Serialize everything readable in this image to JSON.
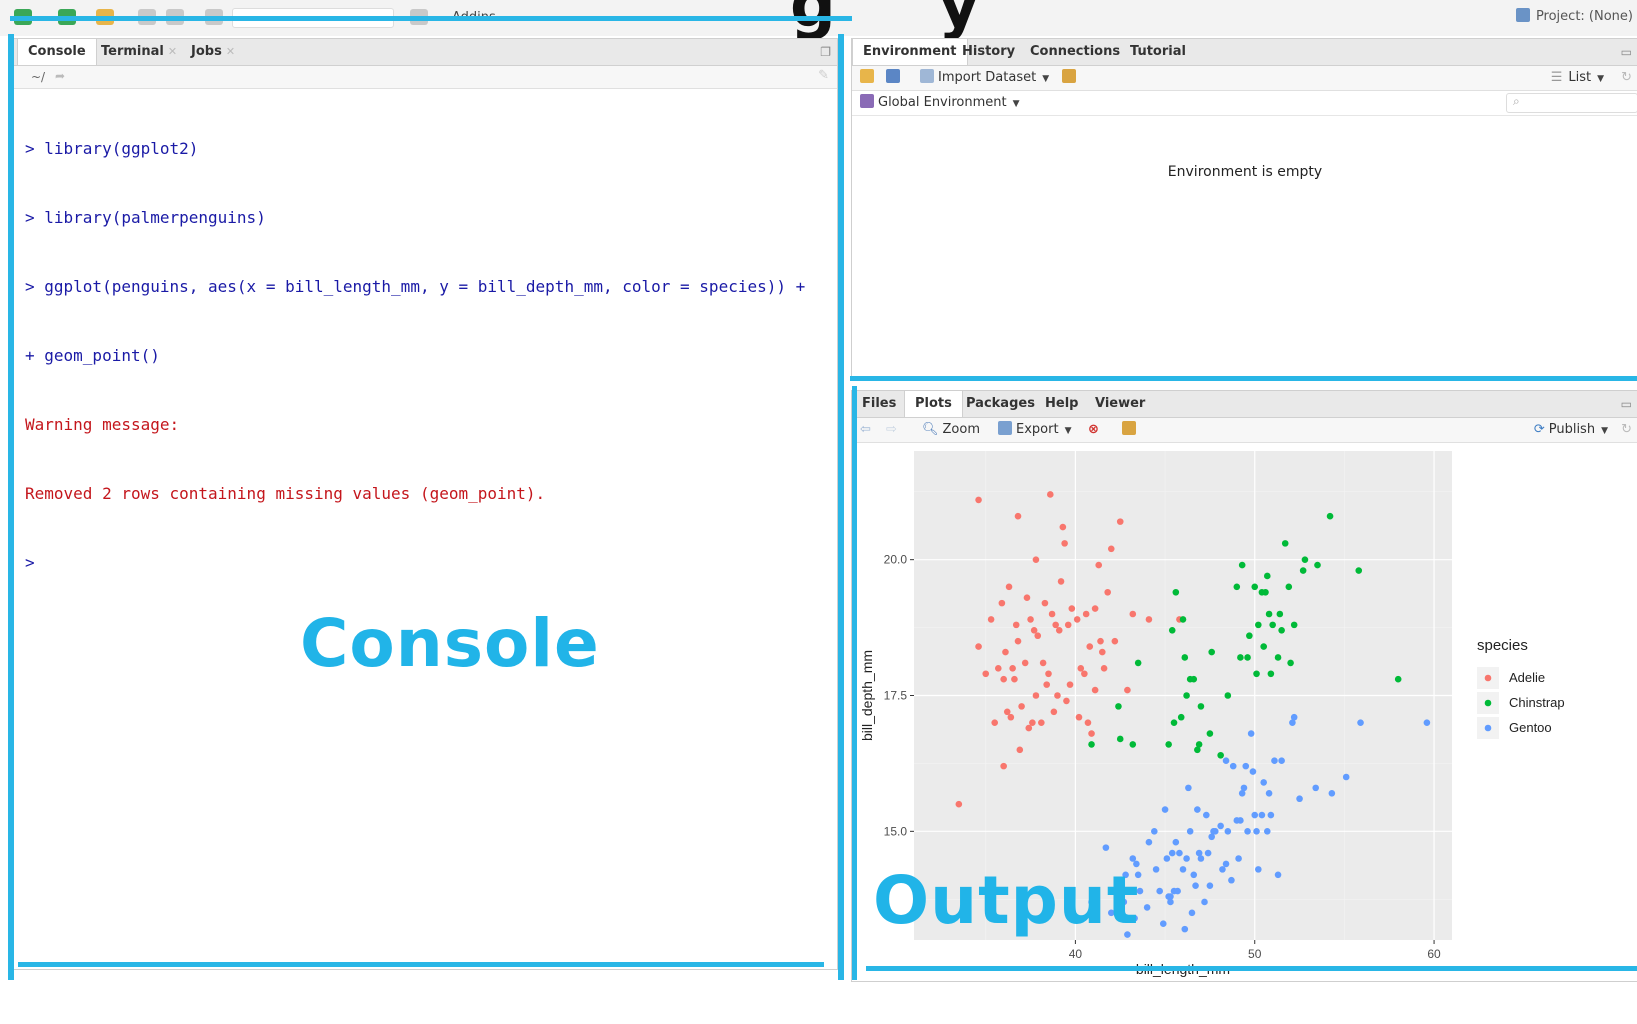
{
  "top_bar": {
    "addins_label": "Addins",
    "project_label": "Project: (None)"
  },
  "console_pane": {
    "tabs": [
      {
        "label": "Console",
        "active": true
      },
      {
        "label": "Terminal",
        "closable": true
      },
      {
        "label": "Jobs",
        "closable": true
      }
    ],
    "path": "~/",
    "lines": [
      {
        "kind": "cmd",
        "text": "> library(ggplot2)"
      },
      {
        "kind": "cmd",
        "text": "> library(palmerpenguins)"
      },
      {
        "kind": "cmd",
        "text": "> ggplot(penguins, aes(x = bill_length_mm, y = bill_depth_mm, color = species)) +"
      },
      {
        "kind": "cmd",
        "text": "+ geom_point()"
      },
      {
        "kind": "warn",
        "text": "Warning message:"
      },
      {
        "kind": "warn",
        "text": "Removed 2 rows containing missing values (geom_point)."
      },
      {
        "kind": "cmd",
        "text": ">"
      }
    ],
    "annotation": "Console"
  },
  "environment_pane": {
    "tabs": [
      "Environment",
      "History",
      "Connections",
      "Tutorial"
    ],
    "active_tab": "Environment",
    "toolbar": {
      "import_label": "Import Dataset",
      "list_label": "List"
    },
    "scope_label": "Global Environment",
    "empty_message": "Environment is empty"
  },
  "output_pane": {
    "tabs": [
      "Files",
      "Plots",
      "Packages",
      "Help",
      "Viewer"
    ],
    "active_tab": "Plots",
    "toolbar": {
      "zoom_label": "Zoom",
      "export_label": "Export",
      "publish_label": "Publish"
    },
    "annotation": "Output"
  },
  "colors": {
    "adelie": "#F8766D",
    "chinstrap": "#00BA38",
    "gentoo": "#619CFF",
    "annotation": "#29B6E6",
    "console_cmd": "#1A1AA6",
    "console_warn": "#C4161C"
  },
  "chart_data": {
    "type": "scatter",
    "xlabel": "bill_length_mm",
    "ylabel": "bill_depth_mm",
    "xlim": [
      31,
      61
    ],
    "ylim": [
      13,
      22
    ],
    "xticks": [
      40,
      50,
      60
    ],
    "yticks": [
      15.0,
      17.5,
      20.0
    ],
    "ytick_labels": [
      "15.0",
      "17.5",
      "20.0"
    ],
    "grid": true,
    "legend_title": "species",
    "legend_position": "right",
    "series": [
      {
        "name": "Adelie",
        "color": "#F8766D",
        "points": [
          [
            33.5,
            15.5
          ],
          [
            34.6,
            18.4
          ],
          [
            34.6,
            21.1
          ],
          [
            35.0,
            17.9
          ],
          [
            35.3,
            18.9
          ],
          [
            35.5,
            17.0
          ],
          [
            35.7,
            18.0
          ],
          [
            36.0,
            16.2
          ],
          [
            36.0,
            17.8
          ],
          [
            36.2,
            17.2
          ],
          [
            36.4,
            17.1
          ],
          [
            36.5,
            18.0
          ],
          [
            36.6,
            17.8
          ],
          [
            36.7,
            18.8
          ],
          [
            36.8,
            18.5
          ],
          [
            36.9,
            16.5
          ],
          [
            37.0,
            17.3
          ],
          [
            37.2,
            18.1
          ],
          [
            37.3,
            19.3
          ],
          [
            37.6,
            17.0
          ],
          [
            37.7,
            18.7
          ],
          [
            37.8,
            17.5
          ],
          [
            37.8,
            20.0
          ],
          [
            38.1,
            17.0
          ],
          [
            38.2,
            18.1
          ],
          [
            38.5,
            17.9
          ],
          [
            38.6,
            21.2
          ],
          [
            38.8,
            17.2
          ],
          [
            38.9,
            18.8
          ],
          [
            39.0,
            17.5
          ],
          [
            39.2,
            19.6
          ],
          [
            39.3,
            20.6
          ],
          [
            39.5,
            17.4
          ],
          [
            39.6,
            18.8
          ],
          [
            39.7,
            17.7
          ],
          [
            40.1,
            18.9
          ],
          [
            40.3,
            18.0
          ],
          [
            40.5,
            17.9
          ],
          [
            40.6,
            19.0
          ],
          [
            40.8,
            18.4
          ],
          [
            41.1,
            17.6
          ],
          [
            41.1,
            19.1
          ],
          [
            41.4,
            18.5
          ],
          [
            41.5,
            18.3
          ],
          [
            41.8,
            19.4
          ],
          [
            42.0,
            20.2
          ],
          [
            42.2,
            18.5
          ],
          [
            42.5,
            20.7
          ],
          [
            42.9,
            17.6
          ],
          [
            43.2,
            19.0
          ],
          [
            44.1,
            18.9
          ],
          [
            45.8,
            18.9
          ],
          [
            39.8,
            19.1
          ],
          [
            36.3,
            19.5
          ],
          [
            37.4,
            16.9
          ],
          [
            38.3,
            19.2
          ],
          [
            40.9,
            16.8
          ],
          [
            39.1,
            18.7
          ],
          [
            41.6,
            18.0
          ],
          [
            37.9,
            18.6
          ],
          [
            36.1,
            18.3
          ],
          [
            38.7,
            19.0
          ],
          [
            40.2,
            17.1
          ],
          [
            35.9,
            19.2
          ],
          [
            39.4,
            20.3
          ],
          [
            40.7,
            17.0
          ],
          [
            37.5,
            18.9
          ],
          [
            38.4,
            17.7
          ],
          [
            41.3,
            19.9
          ],
          [
            36.8,
            20.8
          ]
        ]
      },
      {
        "name": "Chinstrap",
        "color": "#00BA38",
        "points": [
          [
            40.9,
            16.6
          ],
          [
            42.4,
            17.3
          ],
          [
            42.5,
            16.7
          ],
          [
            43.2,
            16.6
          ],
          [
            43.5,
            18.1
          ],
          [
            45.2,
            16.6
          ],
          [
            45.4,
            18.7
          ],
          [
            45.5,
            17.0
          ],
          [
            45.6,
            19.4
          ],
          [
            46.0,
            18.9
          ],
          [
            46.1,
            18.2
          ],
          [
            46.4,
            17.8
          ],
          [
            46.6,
            17.8
          ],
          [
            46.8,
            16.5
          ],
          [
            47.0,
            17.3
          ],
          [
            47.5,
            16.8
          ],
          [
            48.1,
            16.4
          ],
          [
            49.0,
            19.5
          ],
          [
            49.3,
            19.9
          ],
          [
            49.6,
            18.2
          ],
          [
            50.0,
            19.5
          ],
          [
            50.2,
            18.8
          ],
          [
            50.4,
            19.4
          ],
          [
            50.5,
            18.4
          ],
          [
            50.7,
            19.7
          ],
          [
            50.9,
            17.9
          ],
          [
            51.3,
            18.2
          ],
          [
            51.4,
            19.0
          ],
          [
            51.5,
            18.7
          ],
          [
            51.9,
            19.5
          ],
          [
            52.0,
            18.1
          ],
          [
            52.2,
            18.8
          ],
          [
            52.8,
            20.0
          ],
          [
            53.5,
            19.9
          ],
          [
            54.2,
            20.8
          ],
          [
            55.8,
            19.8
          ],
          [
            58.0,
            17.8
          ],
          [
            49.7,
            18.6
          ],
          [
            50.8,
            19.0
          ],
          [
            47.6,
            18.3
          ],
          [
            46.2,
            17.5
          ],
          [
            48.5,
            17.5
          ],
          [
            51.0,
            18.8
          ],
          [
            45.9,
            17.1
          ],
          [
            49.2,
            18.2
          ],
          [
            52.7,
            19.8
          ],
          [
            50.6,
            19.4
          ],
          [
            50.1,
            17.9
          ],
          [
            51.7,
            20.3
          ],
          [
            46.9,
            16.6
          ]
        ]
      },
      {
        "name": "Gentoo",
        "color": "#619CFF",
        "points": [
          [
            40.9,
            13.7
          ],
          [
            41.7,
            14.7
          ],
          [
            42.0,
            13.5
          ],
          [
            42.7,
            13.7
          ],
          [
            42.8,
            14.2
          ],
          [
            42.9,
            13.1
          ],
          [
            43.2,
            14.5
          ],
          [
            43.3,
            13.4
          ],
          [
            43.4,
            14.4
          ],
          [
            43.5,
            14.2
          ],
          [
            43.6,
            13.9
          ],
          [
            44.0,
            13.6
          ],
          [
            44.4,
            15.0
          ],
          [
            44.5,
            14.3
          ],
          [
            44.9,
            13.3
          ],
          [
            45.0,
            15.4
          ],
          [
            45.1,
            14.5
          ],
          [
            45.2,
            13.8
          ],
          [
            45.3,
            13.7
          ],
          [
            45.4,
            14.6
          ],
          [
            45.5,
            13.9
          ],
          [
            45.7,
            13.9
          ],
          [
            45.8,
            14.6
          ],
          [
            46.1,
            13.2
          ],
          [
            46.2,
            14.5
          ],
          [
            46.3,
            15.8
          ],
          [
            46.4,
            15.0
          ],
          [
            46.5,
            13.5
          ],
          [
            46.6,
            14.2
          ],
          [
            46.8,
            15.4
          ],
          [
            46.9,
            14.6
          ],
          [
            47.2,
            13.7
          ],
          [
            47.3,
            15.3
          ],
          [
            47.4,
            14.6
          ],
          [
            47.5,
            14.0
          ],
          [
            47.7,
            15.0
          ],
          [
            47.8,
            15.0
          ],
          [
            48.1,
            15.1
          ],
          [
            48.2,
            14.3
          ],
          [
            48.4,
            14.4
          ],
          [
            48.5,
            15.0
          ],
          [
            48.7,
            14.1
          ],
          [
            49.0,
            15.2
          ],
          [
            49.1,
            14.5
          ],
          [
            49.2,
            15.2
          ],
          [
            49.3,
            15.7
          ],
          [
            49.4,
            15.8
          ],
          [
            49.5,
            16.2
          ],
          [
            49.6,
            15.0
          ],
          [
            49.8,
            16.8
          ],
          [
            50.0,
            15.3
          ],
          [
            50.1,
            15.0
          ],
          [
            50.2,
            14.3
          ],
          [
            50.4,
            15.3
          ],
          [
            50.5,
            15.9
          ],
          [
            50.7,
            15.0
          ],
          [
            50.8,
            15.7
          ],
          [
            51.1,
            16.3
          ],
          [
            51.3,
            14.2
          ],
          [
            51.5,
            16.3
          ],
          [
            52.1,
            17.0
          ],
          [
            52.2,
            17.1
          ],
          [
            52.5,
            15.6
          ],
          [
            53.4,
            15.8
          ],
          [
            54.3,
            15.7
          ],
          [
            55.1,
            16.0
          ],
          [
            55.9,
            17.0
          ],
          [
            59.6,
            17.0
          ],
          [
            45.6,
            14.8
          ],
          [
            44.1,
            14.8
          ],
          [
            48.8,
            16.2
          ],
          [
            47.0,
            14.5
          ],
          [
            48.4,
            16.3
          ],
          [
            45.3,
            13.8
          ],
          [
            46.7,
            14.0
          ],
          [
            50.9,
            15.3
          ],
          [
            47.6,
            14.9
          ],
          [
            49.9,
            16.1
          ],
          [
            44.7,
            13.9
          ],
          [
            46.0,
            14.3
          ]
        ]
      }
    ]
  }
}
